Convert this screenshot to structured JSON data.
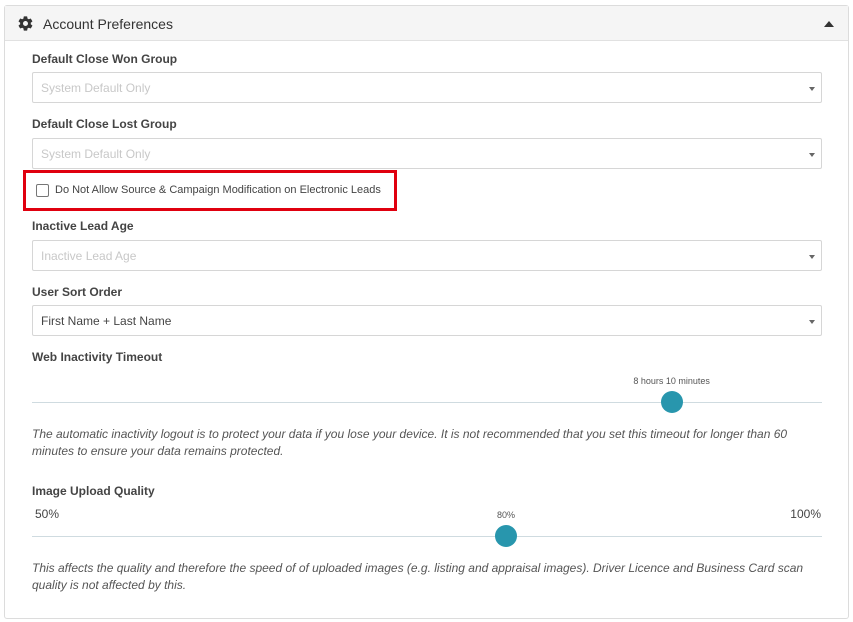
{
  "panel": {
    "title": "Account Preferences"
  },
  "close_won": {
    "label": "Default Close Won Group",
    "value": "System Default Only"
  },
  "close_lost": {
    "label": "Default Close Lost Group",
    "value": "System Default Only"
  },
  "source_mod": {
    "label": "Do Not Allow Source & Campaign Modification on Electronic Leads",
    "checked": false
  },
  "inactive_age": {
    "label": "Inactive Lead Age",
    "value": "Inactive Lead Age"
  },
  "sort_order": {
    "label": "User Sort Order",
    "value": "First Name + Last Name"
  },
  "timeout": {
    "label": "Web Inactivity Timeout",
    "value_label": "8 hours 10 minutes",
    "fraction": 0.81,
    "help": "The automatic inactivity logout is to protect your data if you lose your device. It is not recommended that you set this timeout for longer than 60 minutes to ensure your data remains protected."
  },
  "image_quality": {
    "label": "Image Upload Quality",
    "min_label": "50%",
    "max_label": "100%",
    "value_label": "80%",
    "value": 80,
    "min": 50,
    "max": 100,
    "help": "This affects the quality and therefore the speed of of uploaded images (e.g. listing and appraisal images). Driver Licence and Business Card scan quality is not affected by this."
  },
  "colors": {
    "accent": "#2896ad",
    "highlight": "#e0000f"
  },
  "icons": {
    "header": "gear-icon",
    "collapse": "caret-up-icon",
    "select": "caret-down-icon"
  }
}
